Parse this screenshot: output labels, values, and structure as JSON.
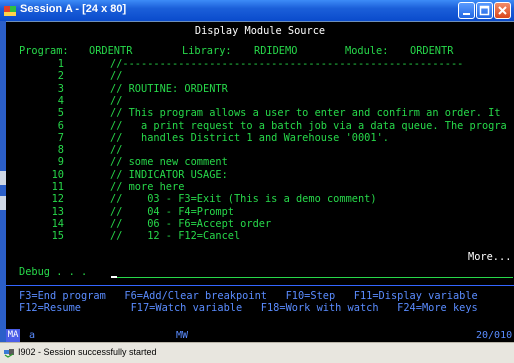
{
  "window": {
    "title": "Session A - [24 x 80]"
  },
  "screen": {
    "header": "Display Module Source",
    "labels_row": {
      "program_label": "Program:",
      "program_value": "ORDENTR",
      "library_label": "Library:",
      "library_value": "RDIDEMO",
      "module_label": "Module:",
      "module_value": "ORDENTR"
    },
    "lines": [
      {
        "num": "1",
        "text": "//-------------------------------------------------------"
      },
      {
        "num": "2",
        "text": "//"
      },
      {
        "num": "3",
        "text": "// ROUTINE: ORDENTR"
      },
      {
        "num": "4",
        "text": "//"
      },
      {
        "num": "5",
        "text": "// This program allows a user to enter and confirm an order. It"
      },
      {
        "num": "6",
        "text": "//   a print request to a batch job via a data queue. The progra"
      },
      {
        "num": "7",
        "text": "//   handles District 1 and Warehouse '0001'."
      },
      {
        "num": "8",
        "text": "//"
      },
      {
        "num": "9",
        "text": "// some new comment"
      },
      {
        "num": "10",
        "text": "// INDICATOR USAGE:"
      },
      {
        "num": "11",
        "text": "// more here"
      },
      {
        "num": "12",
        "text": "//    03 - F3=Exit (This is a demo comment)"
      },
      {
        "num": "13",
        "text": "//    04 - F4=Prompt"
      },
      {
        "num": "14",
        "text": "//    06 - F6=Accept order"
      },
      {
        "num": "15",
        "text": "//    12 - F12=Cancel"
      }
    ],
    "more": "More...",
    "debug_label": "Debug . . .",
    "fkeys_row1": "F3=End program   F6=Add/Clear breakpoint   F10=Step   F11=Display variable",
    "fkeys_row2": "F12=Resume        F17=Watch variable   F18=Work with watch   F24=More keys"
  },
  "oia": {
    "ma": "MA",
    "session": "a",
    "mw": "MW",
    "position": "20/010"
  },
  "status_bar": {
    "text": "I902 - Session successfully started"
  }
}
